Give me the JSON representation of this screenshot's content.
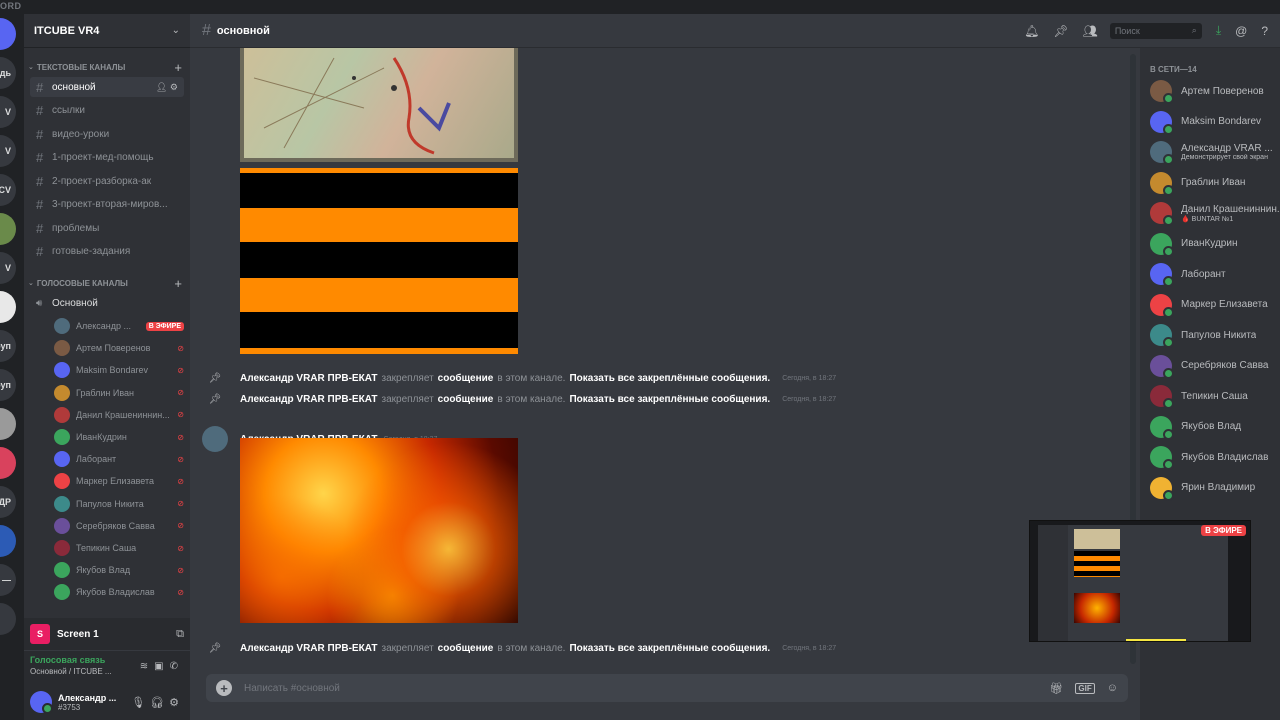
{
  "app": {
    "wordmark": "ORD"
  },
  "rail": [
    {
      "label": "",
      "color": "#5865f2"
    },
    {
      "label": "ведь",
      "color": "#36393f"
    },
    {
      "label": "V",
      "color": "#36393f"
    },
    {
      "label": "V",
      "color": "#36393f"
    },
    {
      "label": "CV",
      "color": "#36393f"
    },
    {
      "label": "",
      "color": "#6a8a4a"
    },
    {
      "label": "V",
      "color": "#36393f"
    },
    {
      "label": "",
      "color": "#e8e8e8"
    },
    {
      "label": "Груп",
      "color": "#36393f"
    },
    {
      "label": "Груп",
      "color": "#36393f"
    },
    {
      "label": "",
      "color": "#9a9a9a"
    },
    {
      "label": "",
      "color": "#d9425d"
    },
    {
      "label": "АНДР",
      "color": "#36393f"
    },
    {
      "label": "",
      "color": "#2c5bb5"
    },
    {
      "label": "—",
      "color": "#36393f"
    },
    {
      "label": "",
      "color": "#36393f"
    }
  ],
  "server": {
    "name": "ITCUBE VR4"
  },
  "categories": {
    "text": "ТЕКСТОВЫЕ КАНАЛЫ",
    "voice": "ГОЛОСОВЫЕ КАНАЛЫ"
  },
  "text_channels": [
    "основной",
    "ссылки",
    "видео-уроки",
    "1-проект-мед-помощь",
    "2-проект-разборка-ак",
    "3-проект-вторая-миров...",
    "проблемы",
    "готовые-задания"
  ],
  "voice_channel": {
    "name": "Основной"
  },
  "voice_users": [
    {
      "name": "Александр ...",
      "live": "В ЭФИРЕ",
      "color": "#4f6b7c"
    },
    {
      "name": "Артем Поверенов",
      "color": "#7a5a44"
    },
    {
      "name": "Maksim Bondarev",
      "color": "#5865f2"
    },
    {
      "name": "Граблин Иван",
      "color": "#c48a2e"
    },
    {
      "name": "Данил Крашениннин...",
      "color": "#b03a3a"
    },
    {
      "name": "ИванКудрин",
      "color": "#3ba55d"
    },
    {
      "name": "Лаборант",
      "color": "#5865f2"
    },
    {
      "name": "Маркер Елизавета",
      "color": "#ed4245"
    },
    {
      "name": "Папулов Никита",
      "color": "#3c8a8a"
    },
    {
      "name": "Серебряков Савва",
      "color": "#6a4f9a"
    },
    {
      "name": "Тепикин Саша",
      "color": "#8a2a3a"
    },
    {
      "name": "Якубов Влад",
      "color": "#3ba55d"
    },
    {
      "name": "Якубов Владислав",
      "color": "#3ba55d"
    }
  ],
  "stream": {
    "label": "Screen 1",
    "initial": "S"
  },
  "voice_status": {
    "title": "Голосовая связь",
    "subtitle": "Основной / ITCUBE ..."
  },
  "current_user": {
    "name": "Александр ...",
    "tag": "#3753"
  },
  "channel_header": {
    "title": "основной",
    "search_placeholder": "Поиск"
  },
  "pin_message": {
    "user": "Александр VRAR ПРВ-ЕКАТ",
    "action": "закрепляет",
    "link": "сообщение",
    "rest": "в этом канале.",
    "show_all": "Показать все закреплённые сообщения.",
    "time": "Сегодня, в 18:27"
  },
  "message": {
    "user": "Александр VRAR ПРВ-ЕКАТ",
    "time": "Сегодня, в 18:27"
  },
  "composer": {
    "placeholder": "Написать #основной",
    "gif": "GIF"
  },
  "members": {
    "category": "В СЕТИ—14",
    "list": [
      {
        "name": "Артем Поверенов",
        "color": "#7a5a44",
        "status": ""
      },
      {
        "name": "Maksim Bondarev",
        "color": "#5865f2",
        "status": ""
      },
      {
        "name": "Александр VRAR ...",
        "color": "#4f6b7c",
        "status": "Демонстрирует свой экран"
      },
      {
        "name": "Граблин Иван",
        "color": "#c48a2e",
        "status": ""
      },
      {
        "name": "Данил Крашениннин...",
        "color": "#b03a3a",
        "status": "🩸 BUNTAR №1"
      },
      {
        "name": "ИванКудрин",
        "color": "#3ba55d",
        "status": ""
      },
      {
        "name": "Лаборант",
        "color": "#5865f2",
        "status": ""
      },
      {
        "name": "Маркер Елизавета",
        "color": "#ed4245",
        "status": ""
      },
      {
        "name": "Папулов Никита",
        "color": "#3c8a8a",
        "status": ""
      },
      {
        "name": "Серебряков Савва",
        "color": "#6a4f9a",
        "status": ""
      },
      {
        "name": "Тепикин Саша",
        "color": "#8a2a3a",
        "status": ""
      },
      {
        "name": "Якубов Влад",
        "color": "#3ba55d",
        "status": ""
      },
      {
        "name": "Якубов Владислав",
        "color": "#3ba55d",
        "status": ""
      },
      {
        "name": "Ярин Владимир",
        "color": "#f0b232",
        "status": ""
      }
    ]
  },
  "preview": {
    "live": "В ЭФИРЕ"
  }
}
